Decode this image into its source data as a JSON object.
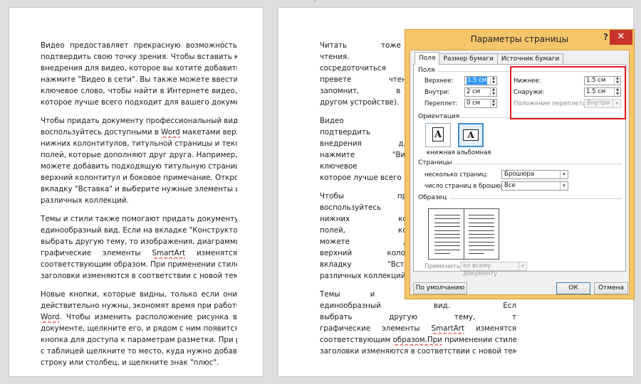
{
  "page1": {
    "paragraphs": [
      [
        "Видео предоставляет прекрасную возможность",
        "подтвердить свою точку зрения. Чтобы вставить код",
        "внедрения для видео, которое вы хотите добавить,",
        "нажмите \"Видео в сети\". Вы также можете ввести",
        "ключевое слово, чтобы найти в Интернете видео,",
        "которое лучше всего подходит для вашего документа."
      ],
      [
        "Чтобы придать документу профессиональный вид,",
        "воспользуйтесь доступными в Word макетами верхних и",
        "нижних колонтитулов, титульной страницы и текстовых",
        "полей, которые дополняют друг друга. Например, вы",
        "можете добавить подходящую титульную страницу,",
        "верхний колонтитул и боковое примечание. Откройте",
        "вкладку \"Вставка\" и выберите нужные элементы из",
        "различных коллекций."
      ],
      [
        "Темы и стили также помогают придать документу",
        "единообразный вид. Если на вкладке \"Конструктор\"",
        "выбрать другую тему, то изображения, диаграммы и",
        "графические элементы SmartArt изменятся",
        "соответствующим образом. При применении стилей",
        "заголовки изменяются в соответствии с новой темой."
      ],
      [
        "Новые кнопки, которые видны, только если они",
        "действительно нужны, экономят время при работе в",
        "Word. Чтобы изменить расположение рисунка в",
        "документе, щелкните его, и рядом с ним появится",
        "кнопка для доступа к параметрам разметки. При работе",
        "с таблицей щелкните то место, куда нужно добавить",
        "строку или столбец, и щелкните знак \"плюс\"."
      ]
    ]
  },
  "page2": {
    "paragraphs": [
      [
        "Читать тоже стало проще",
        "чтения. Можно свернут",
        "сосредоточиться на нужн",
        "превете чтение, не дой",
        "запомнит, в каком мест",
        "другом устройстве)."
      ],
      [
        "Видео предоставляет",
        "подтвердить свою точку",
        "внедрения для видео, к",
        "нажмите \"Видео в сети",
        "ключевое слово, чтобы",
        "которое лучше всего под"
      ],
      [
        "Чтобы придать докумен",
        "воспользуйтесь доступны",
        "нижних колонтитулов, тит",
        "полей, которые дополня",
        "можете добавить подхо",
        "верхний колонтитул и бо",
        "вкладку \"Вставка\" и выб",
        "различных коллекций."
      ],
      [
        "Темы и стили также п",
        "единообразный вид. Есл",
        "выбрать другую тему, т",
        "графические элементы SmartArt изменятся",
        "соответствующим образом.При применении стилей",
        "заголовки изменяются в соответствии с новой темой."
      ]
    ]
  },
  "dialog": {
    "title": "Параметры страницы",
    "help": "?",
    "close": "✕",
    "tabs": [
      "Поля",
      "Размер бумаги",
      "Источник бумаги"
    ],
    "margins_group": "Поля",
    "top_label": "Верхнее:",
    "top_value": "1.5 см",
    "inside_label": "Внутри:",
    "inside_value": "2 см",
    "gutter_label": "Переплет:",
    "gutter_value": "0 см",
    "bottom_label": "Нижнее:",
    "bottom_value": "1.5 см",
    "outside_label": "Снаружи:",
    "outside_value": "1.5 см",
    "gutter_pos_label": "Положение переплета:",
    "gutter_pos_value": "Внутри",
    "orientation_group": "Ориентация",
    "portrait_label": "книжная",
    "landscape_label": "альбомная",
    "orientation_glyph": "A",
    "pages_group": "Страницы",
    "multiple_pages_label": "несколько страниц:",
    "multiple_pages_value": "Брошюра",
    "sheets_label": "число страниц в брошюре:",
    "sheets_value": "Все",
    "preview_group": "Образец",
    "apply_label": "Применить:",
    "apply_value": "ко всему документу",
    "default_button": "По умолчанию",
    "ok_button": "ОК",
    "cancel_button": "Отмена"
  },
  "colors": {
    "dialog_frame": "#f5c56a",
    "close_button": "#c7342b",
    "highlight_box": "#e0191c",
    "selection": "#3399ff"
  }
}
